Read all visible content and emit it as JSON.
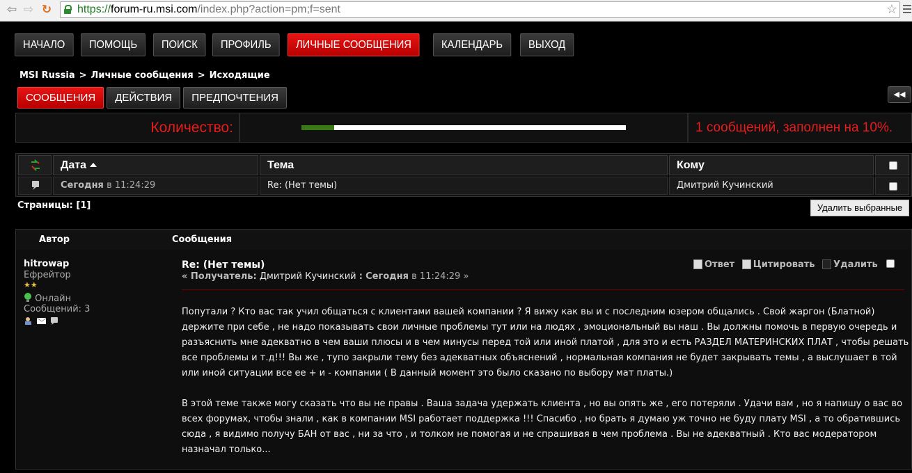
{
  "browser": {
    "url_scheme": "https://",
    "url_host": "forum-ru.msi.com",
    "url_path": "/index.php?action=pm;f=sent"
  },
  "main_nav": [
    {
      "label": "НАЧАЛО",
      "active": false
    },
    {
      "label": "ПОМОЩЬ",
      "active": false
    },
    {
      "label": "ПОИСК",
      "active": false
    },
    {
      "label": "ПРОФИЛЬ",
      "active": false
    },
    {
      "label": "ЛИЧНЫЕ СООБЩЕНИЯ",
      "active": true
    },
    {
      "label": "КАЛЕНДАРЬ",
      "active": false
    },
    {
      "label": "ВЫХОД",
      "active": false
    }
  ],
  "breadcrumb": [
    "MSI Russia",
    "Личные сообщения",
    "Исходящие"
  ],
  "breadcrumb_sep": ">",
  "sub_nav": [
    {
      "label": "СООБЩЕНИЯ",
      "active": true
    },
    {
      "label": "ДЕЙСТВИЯ",
      "active": false
    },
    {
      "label": "ПРЕДПОЧТЕНИЯ",
      "active": false
    }
  ],
  "quota": {
    "label": "Количество:",
    "percent": 10,
    "text": "1 сообщений, заполнен на 10%."
  },
  "table": {
    "headers": {
      "date": "Дата",
      "subject": "Тема",
      "to": "Кому"
    },
    "rows": [
      {
        "date_word": "Сегодня",
        "date_time": "в 11:24:29",
        "subject": "Re: (Нет темы)",
        "to": "Дмитрий Кучинский"
      }
    ]
  },
  "pages": {
    "label": "Страницы:",
    "value": "[1]"
  },
  "delete_selected": "Удалить выбранные",
  "message_view": {
    "col_author": "Автор",
    "col_messages": "Сообщения",
    "poster": {
      "name": "hitrowap",
      "rank": "Ефрейтор",
      "stars": "★★",
      "status": "Онлайн",
      "posts": "Сообщений: 3"
    },
    "title": "Re: (Нет темы)",
    "meta_open": "« Получатель:",
    "meta_recipient": "Дмитрий Кучинский",
    "meta_colon": ":",
    "meta_word": "Сегодня",
    "meta_time": "в 11:24:29 »",
    "actions": {
      "reply": "Ответ",
      "quote": "Цитировать",
      "delete": "Удалить"
    },
    "body": [
      "Попутали ? Кто вас так учил общаться с клиентами вашей компании ? Я вижу как вы и с последним юзером общались . Свой жаргон (Блатной) держите при себе , не надо показывать свои личные проблемы тут или на людях , эмоциональный вы наш . Вы должны помочь в первую очередь и разъяснить мне адекватно в чем ваши плюсы и в чем минусы перед той или иной платой , для это и есть РАЗДЕЛ МАТЕРИНСКИХ ПЛАТ , чтобы решать все проблемы и т.д!!! Вы же , тупо закрыли тему без адекватных объяснений , нормальная компания не будет закрывать темы , а выслушает в той или иной ситуации все ее + и - компании ( В данный момент это было сказано по выбору мат платы.)",
      "В этой теме также могу сказать что вы не правы . Ваша задача удержать клиента , но вы опять же , его потеряли . Удачи вам , но я напишу о вас во всех форумах, чтобы знали , как в компании MSI работает поддержка !!! Спасибо , но брать я думаю уж точно не буду плату MSI , а то обратившись сюда , я видимо получу БАН от вас , ни за что , и толком не помогая и не спрашивая в чем проблема . Вы не адекватный . Кто вас модератором назначал только..."
    ]
  }
}
